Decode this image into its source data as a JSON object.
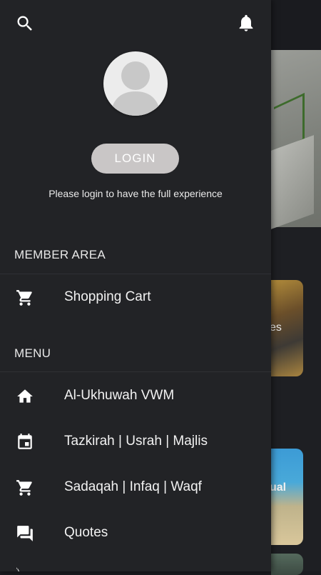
{
  "drawer": {
    "login_label": "LOGIN",
    "login_message": "Please login to have the full experience",
    "member_area": {
      "title": "MEMBER AREA",
      "items": [
        {
          "label": "Shopping Cart",
          "icon": "cart-icon"
        }
      ]
    },
    "menu": {
      "title": "MENU",
      "items": [
        {
          "label": "Al-Ukhuwah VWM",
          "icon": "home-icon"
        },
        {
          "label": "Tazkirah | Usrah | Majlis",
          "icon": "calendar-icon"
        },
        {
          "label": "Sadaqah | Infaq | Waqf",
          "icon": "cart-icon"
        },
        {
          "label": "Quotes",
          "icon": "chat-icon"
        }
      ]
    }
  },
  "background": {
    "card1_text": "es",
    "card2_text": "ual"
  },
  "colors": {
    "drawer_bg": "#222326",
    "login_button": "#c9c6c6",
    "text": "#f2f2f2"
  }
}
